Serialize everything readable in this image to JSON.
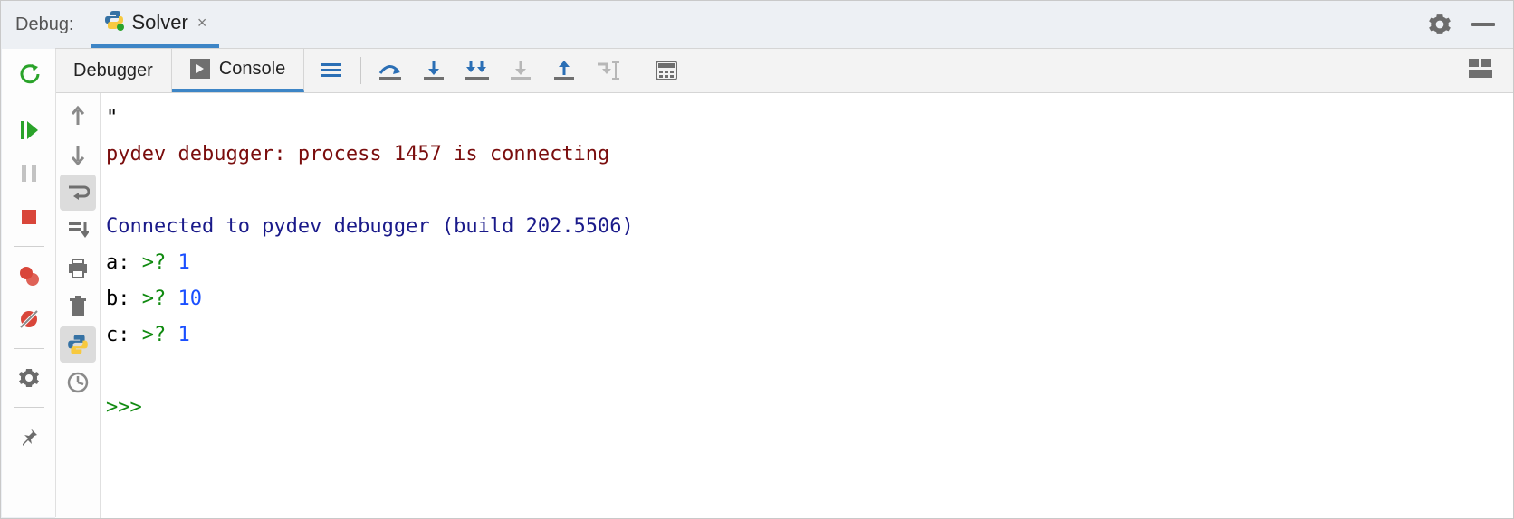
{
  "titlebar": {
    "label": "Debug:",
    "tab_name": "Solver",
    "close_glyph": "×"
  },
  "toolbar": {
    "tabs": {
      "debugger": "Debugger",
      "console": "Console"
    }
  },
  "console": {
    "line1_quote": "\"",
    "line2_msg": "pydev debugger: process 1457 is connecting",
    "line3_blank": "",
    "line4_connected": "Connected to pydev debugger (build 202.5506)",
    "inputs": [
      {
        "var": "a:",
        "prompt": ">?",
        "value": "1"
      },
      {
        "var": "b:",
        "prompt": ">?",
        "value": "10"
      },
      {
        "var": "c:",
        "prompt": ">?",
        "value": "1"
      }
    ],
    "blank_after": "",
    "repl_prompt": ">>> "
  },
  "colors": {
    "accent": "#3d85c6",
    "rerun_green": "#2aa32a",
    "resume_green": "#2aa32a",
    "stop_red": "#d9463a",
    "step_blue": "#2b6fb5",
    "disabled_gray": "#9d9d9d"
  }
}
